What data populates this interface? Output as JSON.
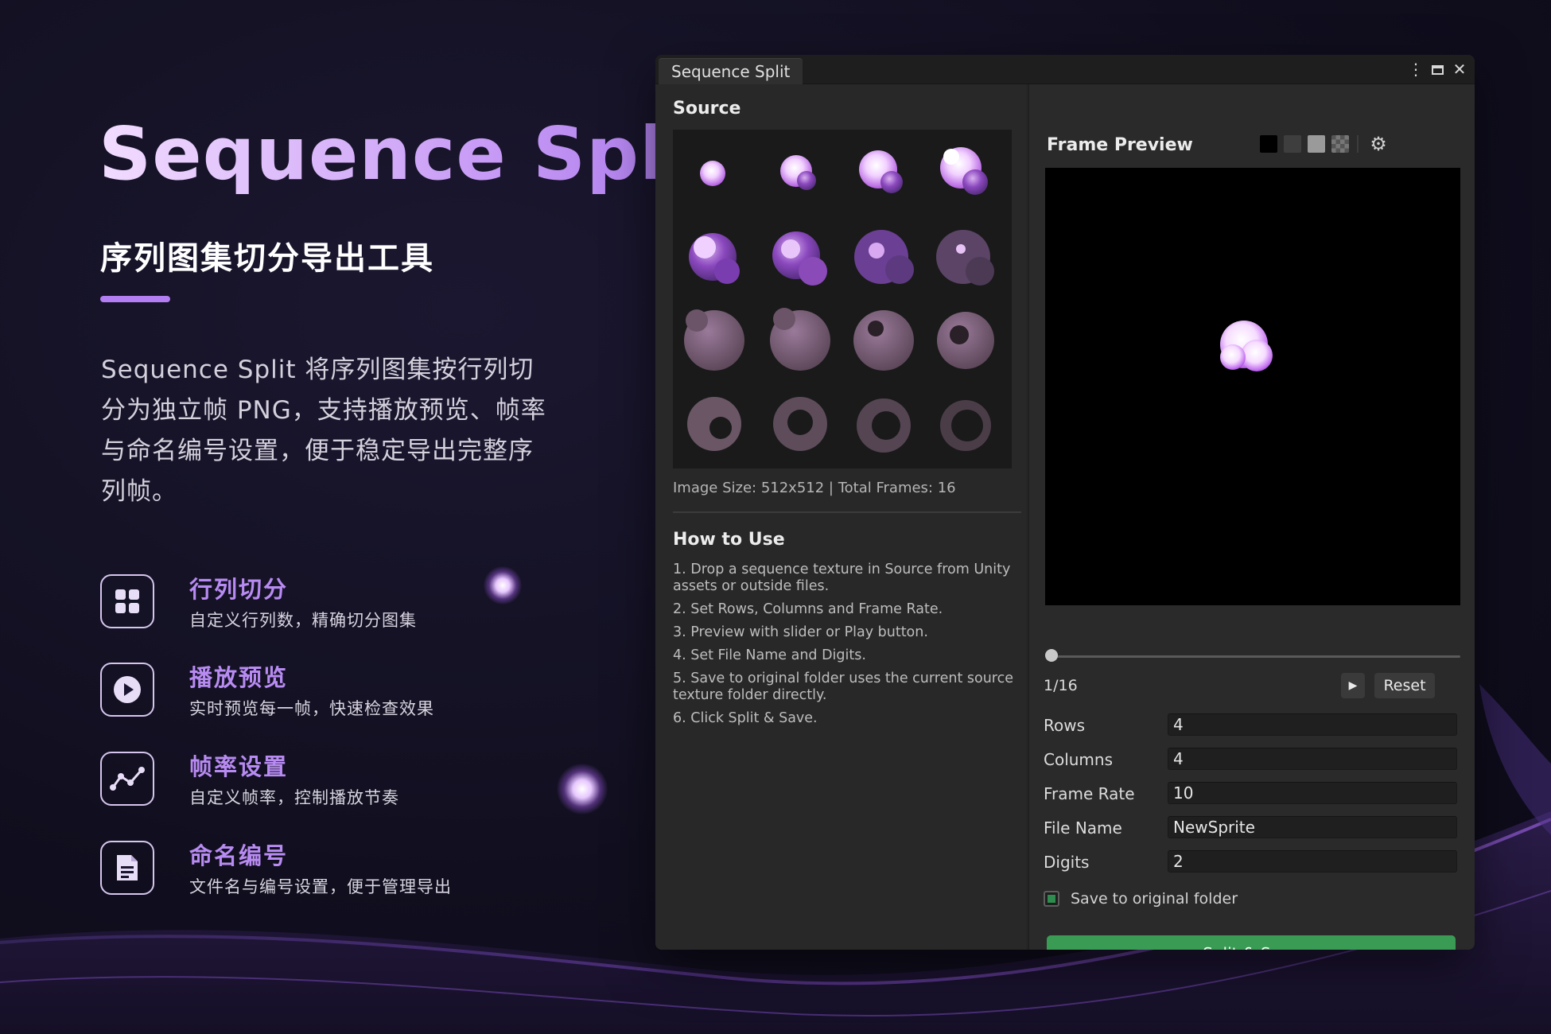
{
  "hero": {
    "title": "Sequence Split",
    "subtitle": "序列图集切分导出工具",
    "description": "Sequence Split 将序列图集按行列切分为独立帧 PNG，支持播放预览、帧率与命名编号设置，便于稳定导出完整序列帧。"
  },
  "features": [
    {
      "icon": "grid-icon",
      "title": "行列切分",
      "desc": "自定义行列数，精确切分图集"
    },
    {
      "icon": "play-circle-icon",
      "title": "播放预览",
      "desc": "实时预览每一帧，快速检查效果"
    },
    {
      "icon": "line-chart-icon",
      "title": "帧率设置",
      "desc": "自定义帧率，控制播放节奏"
    },
    {
      "icon": "document-icon",
      "title": "命名编号",
      "desc": "文件名与编号设置，便于管理导出"
    }
  ],
  "window": {
    "tab_title": "Sequence Split",
    "source_heading": "Source",
    "image_info": "Image Size: 512x512 | Total Frames: 16",
    "howto_title": "How to Use",
    "howto_steps": [
      "1. Drop a sequence texture in Source from Unity assets or outside files.",
      "2. Set Rows, Columns and Frame Rate.",
      "3. Preview with slider or Play button.",
      "4. Set File Name and Digits.",
      "5. Save to original folder uses the current source texture folder directly.",
      "6. Click Split & Save."
    ],
    "preview_title": "Frame Preview",
    "frame_counter": "1/16",
    "play_symbol": "▶",
    "reset_label": "Reset",
    "fields": [
      {
        "label": "Rows",
        "value": "4"
      },
      {
        "label": "Columns",
        "value": "4"
      },
      {
        "label": "Frame Rate",
        "value": "10"
      },
      {
        "label": "File Name",
        "value": "NewSprite"
      },
      {
        "label": "Digits",
        "value": "2"
      }
    ],
    "save_to_original": {
      "label": "Save to original folder",
      "checked": true
    },
    "split_button": "Split & Save",
    "slider_progress": 0.0
  },
  "colors": {
    "accent": "#b47ef3",
    "button_green": "#3a9b55",
    "background": "#110f1f"
  }
}
